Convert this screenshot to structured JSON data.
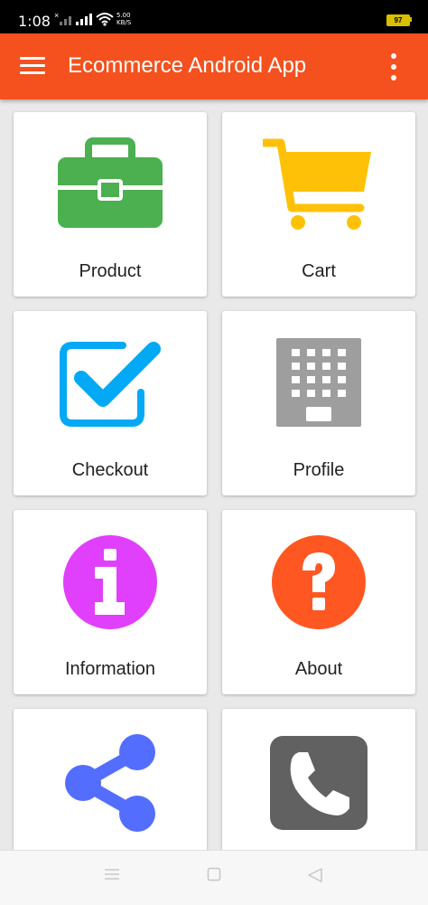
{
  "status_bar": {
    "time": "1:08",
    "net_speed_value": "5.00",
    "net_speed_unit": "KB/S",
    "battery": "97",
    "x_mark": "×"
  },
  "app_bar": {
    "title": "Ecommerce Android App"
  },
  "tiles": [
    {
      "label": "Product",
      "icon": "briefcase-icon",
      "color": "#4caf50"
    },
    {
      "label": "Cart",
      "icon": "shopping-cart-icon",
      "color": "#ffc107"
    },
    {
      "label": "Checkout",
      "icon": "checkbox-checked-icon",
      "color": "#03a9f4"
    },
    {
      "label": "Profile",
      "icon": "building-icon",
      "color": "#9e9e9e"
    },
    {
      "label": "Information",
      "icon": "info-icon",
      "color": "#e040fb"
    },
    {
      "label": "About",
      "icon": "question-icon",
      "color": "#ff5722"
    },
    {
      "label": "",
      "icon": "share-icon",
      "color": "#536dfe"
    },
    {
      "label": "",
      "icon": "phone-icon",
      "color": "#616161"
    }
  ],
  "colors": {
    "app_bar": "#f4511e",
    "background": "#e9e9e9"
  },
  "nav_bar": {
    "buttons": [
      "menu-nav-icon",
      "home-nav-icon",
      "back-nav-icon"
    ]
  }
}
